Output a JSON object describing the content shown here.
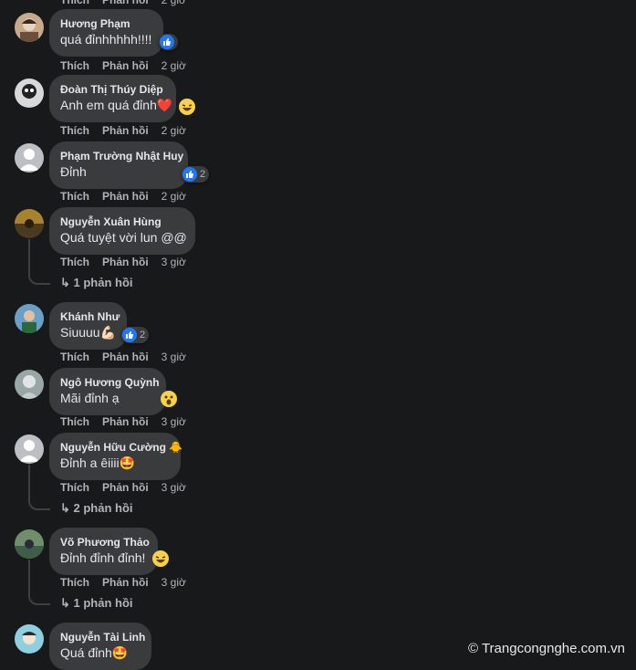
{
  "labels": {
    "like": "Thích",
    "reply": "Phản hồi"
  },
  "top_partial": {
    "actions": "Thích   Phản hồi   2 giờ"
  },
  "comments": [
    {
      "name": "Hương Phạm",
      "text": "quá đỉnhhhhh!!!!",
      "time": "2 giờ",
      "reaction": "like",
      "reaction_count": ""
    },
    {
      "name": "Đoàn Thị Thúy Diệp",
      "text": "Anh em quá đỉnh❤️",
      "time": "2 giờ",
      "reaction": "haha-icon"
    },
    {
      "name": "Phạm Trường Nhật Huy",
      "text": "Đỉnh",
      "time": "2 giờ",
      "reaction": "like",
      "reaction_count": "2"
    },
    {
      "name": "Nguyễn Xuân Hùng",
      "text": "Quá tuyệt vời lun @@",
      "time": "3 giờ",
      "replies": "1 phản hồi"
    },
    {
      "name": "Khánh Như",
      "text": "Siuuuu💪🏻",
      "time": "3 giờ",
      "reaction": "like",
      "reaction_count": "2"
    },
    {
      "name": "Ngô Hương Quỳnh",
      "text": "Mãi đỉnh ạ",
      "time": "3 giờ",
      "reaction": "wow-icon"
    },
    {
      "name": "Nguyễn Hữu Cường 🐥",
      "text": "Đỉnh a êiiii🤩",
      "time": "3 giờ",
      "replies": "2 phản hồi"
    },
    {
      "name": "Võ Phương Thảo",
      "text": "Đỉnh đỉnh đỉnh!",
      "time": "3 giờ",
      "reaction": "haha-icon",
      "replies": "1 phản hồi"
    },
    {
      "name": "Nguyễn Tài Linh",
      "text": "Quá đỉnh🤩",
      "time": ""
    }
  ],
  "watermark": "© Trangcongnghe.com.vn",
  "colors": {
    "bg": "#18191a",
    "bubble": "#3a3b3c",
    "like_blue": "#2078f4"
  }
}
